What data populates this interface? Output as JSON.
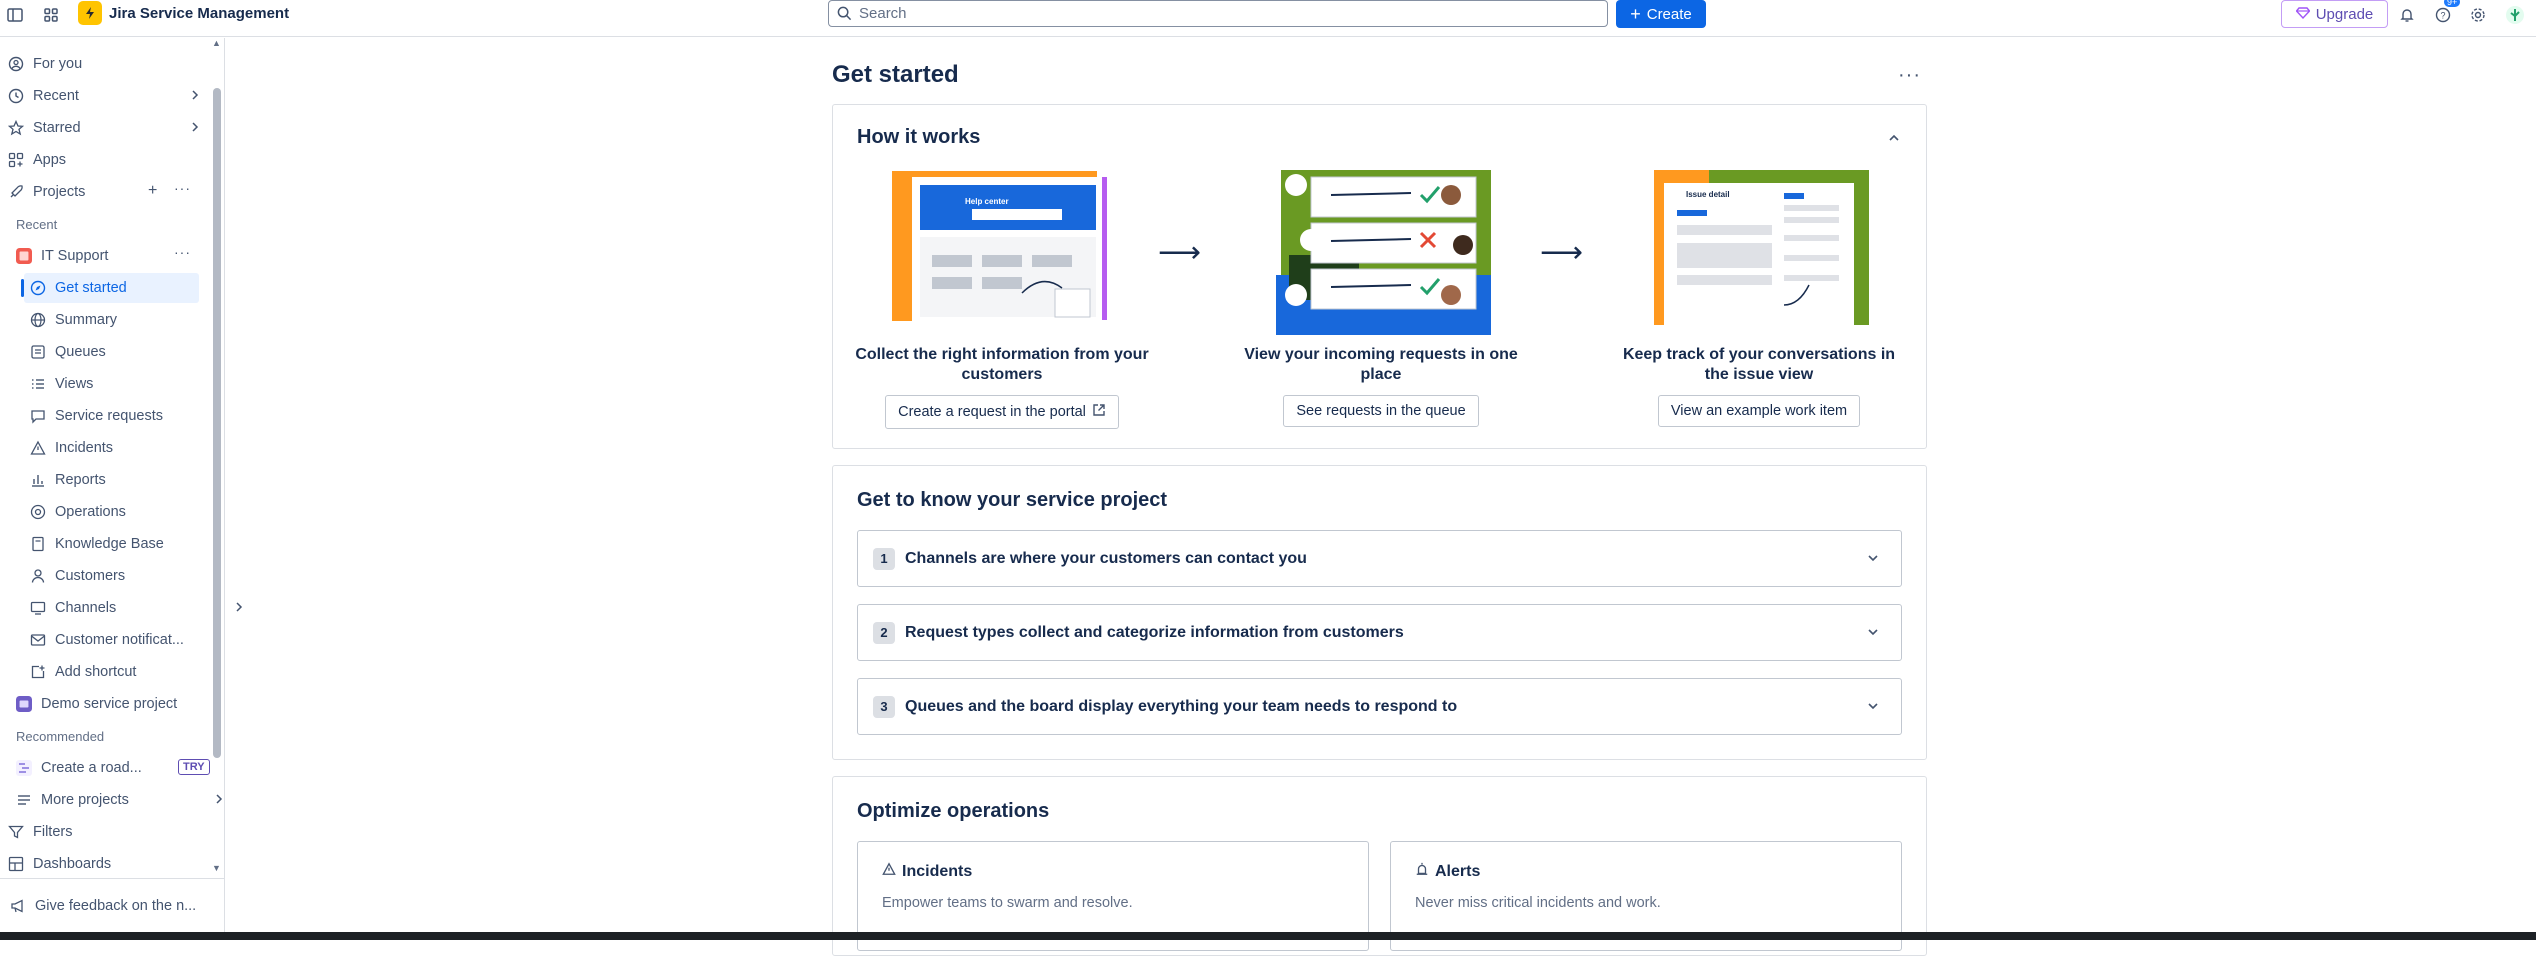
{
  "topbar": {
    "app_name": "Jira Service Management",
    "search_placeholder": "Search",
    "create_label": "Create",
    "upgrade_label": "Upgrade",
    "notif_badge": "9+"
  },
  "sidebar": {
    "for_you": "For you",
    "recent": "Recent",
    "starred": "Starred",
    "apps": "Apps",
    "projects": "Projects",
    "section_recent": "Recent",
    "it_support": "IT Support",
    "items": [
      {
        "label": "Get started",
        "icon": "compass-icon"
      },
      {
        "label": "Summary",
        "icon": "globe-icon"
      },
      {
        "label": "Queues",
        "icon": "queues-icon"
      },
      {
        "label": "Views",
        "icon": "list-icon"
      },
      {
        "label": "Service requests",
        "icon": "chat-icon"
      },
      {
        "label": "Incidents",
        "icon": "warning-icon"
      },
      {
        "label": "Reports",
        "icon": "chart-icon"
      },
      {
        "label": "Operations",
        "icon": "operations-icon"
      },
      {
        "label": "Knowledge Base",
        "icon": "book-icon"
      },
      {
        "label": "Customers",
        "icon": "person-icon"
      },
      {
        "label": "Channels",
        "icon": "monitor-icon"
      },
      {
        "label": "Customer notificat...",
        "icon": "mail-icon"
      },
      {
        "label": "Add shortcut",
        "icon": "add-shortcut-icon"
      }
    ],
    "demo_project": "Demo service project",
    "section_recommended": "Recommended",
    "create_road": "Create a road...",
    "try_badge": "TRY",
    "more_projects": "More projects",
    "filters": "Filters",
    "dashboards": "Dashboards",
    "feedback": "Give feedback on the n..."
  },
  "main": {
    "title": "Get started",
    "how": {
      "title": "How it works",
      "help_center": "Help center",
      "issue_detail": "Issue detail",
      "steps": [
        {
          "text": "Collect the right information from your customers",
          "button": "Create a request in the portal"
        },
        {
          "text": "View your incoming requests in one place",
          "button": "See requests in the queue"
        },
        {
          "text": "Keep track of your conversations in the issue view",
          "button": "View an example work item"
        }
      ]
    },
    "know": {
      "title": "Get to know your service project",
      "items": [
        {
          "num": "1",
          "text": "Channels are where your customers can contact you"
        },
        {
          "num": "2",
          "text": "Request types collect and categorize information from customers"
        },
        {
          "num": "3",
          "text": "Queues and the board display everything your team needs to respond to"
        }
      ]
    },
    "optimize": {
      "title": "Optimize operations",
      "cards": [
        {
          "title": "Incidents",
          "desc": "Empower teams to swarm and resolve."
        },
        {
          "title": "Alerts",
          "desc": "Never miss critical incidents and work."
        }
      ]
    }
  },
  "colors": {
    "accent": "#0C66E4",
    "upgrade": "#5E4DB2",
    "logo": "#FFC400"
  }
}
